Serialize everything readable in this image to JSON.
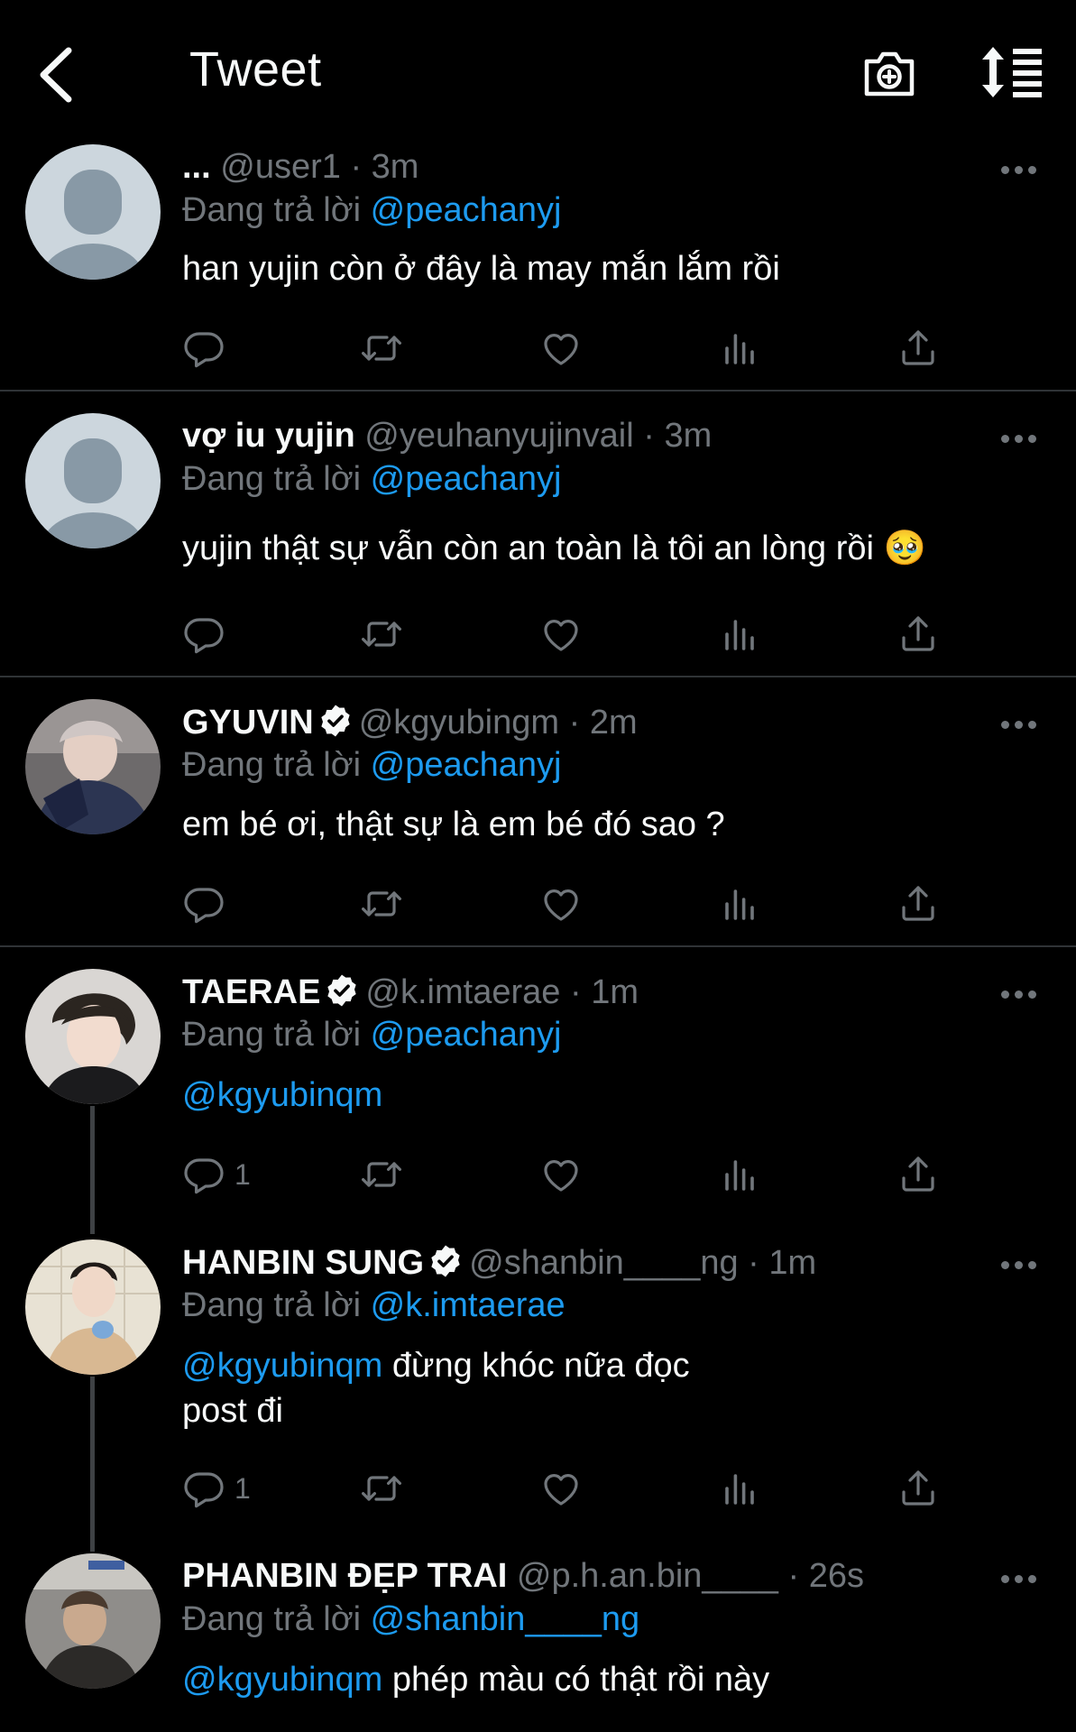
{
  "header": {
    "title": "Tweet"
  },
  "replying_prefix": "Đang trả lời",
  "tweets": [
    {
      "name": "...",
      "handle": "@user1",
      "time": "3m",
      "reply_to": "@peachanyj",
      "text_pre": "",
      "text_mention": "",
      "text": "han yujin còn ở đây là may mắn lắm rồi",
      "reply_count": ""
    },
    {
      "name": "vợ iu yujin",
      "handle": "@yeuhanyujinvail",
      "time": "3m",
      "reply_to": "@peachanyj",
      "text_pre": "",
      "text_mention": "",
      "text": "yujin thật sự vẫn còn an toàn là tôi an lòng rồi 🥹",
      "reply_count": ""
    },
    {
      "name": "GYUVIN",
      "handle": "@kgyubingm",
      "time": "2m",
      "reply_to": "@peachanyj",
      "text_mention": "",
      "text": "em bé ơi, thật sự là em bé đó sao ?",
      "reply_count": ""
    },
    {
      "name": "TAERAE",
      "handle": "@k.imtaerae",
      "time": "1m",
      "reply_to": "@peachanyj",
      "text_mention": "@kgyubinqm",
      "text": "",
      "reply_count": "1"
    },
    {
      "name": "HANBIN SUNG",
      "handle": "@shanbin____ng",
      "time": "1m",
      "reply_to": "@k.imtaerae",
      "text_mention": "@kgyubinqm",
      "text": " đừng khóc nữa đọc",
      "text_line2": "post đi",
      "reply_count": "1"
    },
    {
      "name": "PHANBIN ĐẸP TRAI",
      "handle": "@p.h.an.bin____",
      "time": "26s",
      "reply_to": "@shanbin____ng",
      "text_mention": "@kgyubinqm",
      "text": " phép màu có thật rồi này",
      "reply_count": ""
    }
  ],
  "colors": {
    "background": "#000000",
    "accent": "#1d9bf0",
    "muted": "#71767b",
    "divider": "#2f3336"
  },
  "icons": [
    "back-arrow-icon",
    "camera-plus-icon",
    "sort-icon",
    "more-icon",
    "reply-icon",
    "retweet-icon",
    "like-icon",
    "views-icon",
    "share-icon",
    "verified-badge-icon"
  ]
}
